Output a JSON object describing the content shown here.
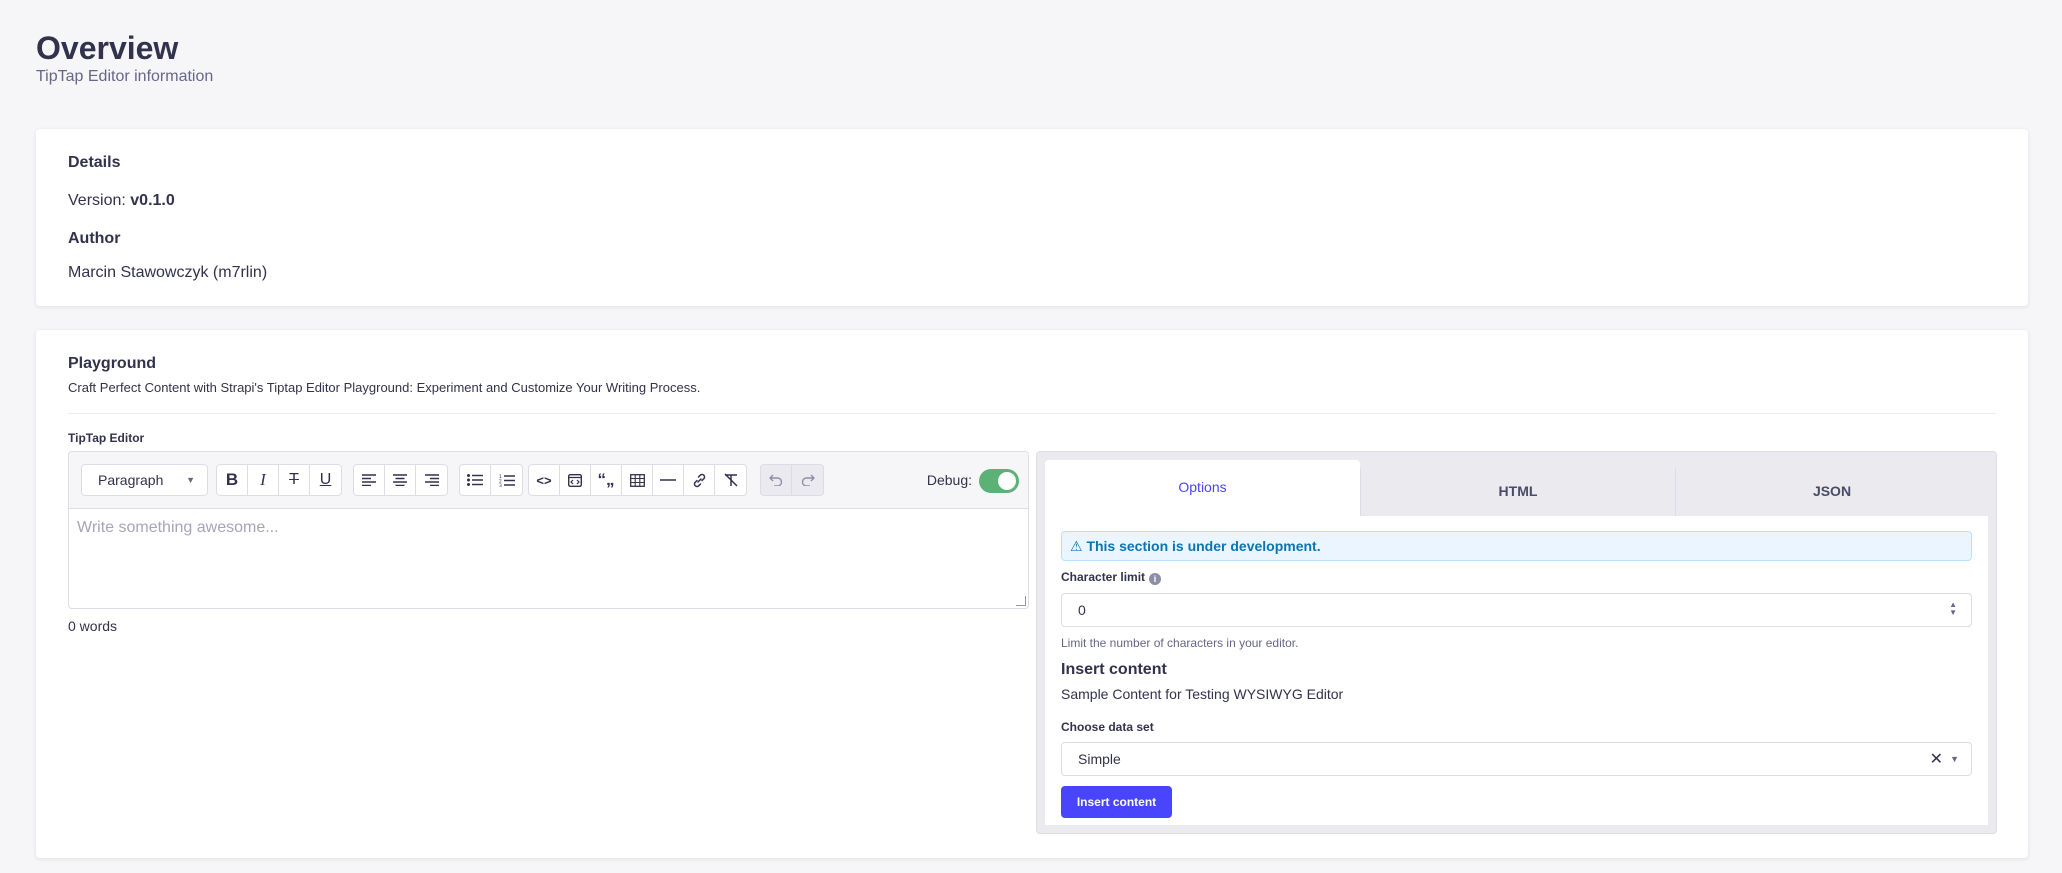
{
  "header": {
    "title": "Overview",
    "subtitle": "TipTap Editor information"
  },
  "details": {
    "heading": "Details",
    "version_label": "Version:",
    "version_value": "v0.1.0",
    "author_heading": "Author",
    "author_name": "Marcin Stawowczyk (m7rlin)"
  },
  "playground": {
    "title": "Playground",
    "description": "Craft Perfect Content with Strapi's Tiptap Editor Playground: Experiment and Customize Your Writing Process.",
    "editor_label": "TipTap Editor",
    "toolbar": {
      "block_type": "Paragraph",
      "debug_label": "Debug:",
      "debug_on": true,
      "icons": {
        "bold": "B",
        "italic": "I",
        "strike": "T",
        "underline": "U",
        "align_left": "≡",
        "align_center": "≡",
        "align_right": "≡",
        "bullet_list": "☰",
        "ordered_list": "☷",
        "code": "<>",
        "code_block": "⧉",
        "blockquote": "“„",
        "table": "▦",
        "hr": "—",
        "link": "🔗",
        "clear_format": "T̸",
        "undo": "↶",
        "redo": "↷"
      }
    },
    "editor_placeholder": "Write something awesome...",
    "word_count": "0 words"
  },
  "options_panel": {
    "tabs": [
      "Options",
      "HTML",
      "JSON"
    ],
    "active_tab": "Options",
    "alert": "⚠ This section is under development.",
    "char_limit_label": "Character limit",
    "char_limit_value": "0",
    "char_limit_hint": "Limit the number of characters in your editor.",
    "insert_title": "Insert content",
    "insert_subtitle": "Sample Content for Testing WYSIWYG Editor",
    "dataset_label": "Choose data set",
    "dataset_value": "Simple",
    "insert_button": "Insert content"
  },
  "colors": {
    "accent": "#4945ff",
    "toggle_on": "#5cb176",
    "alert_bg": "#eaf5ff",
    "alert_text": "#0c75af"
  }
}
